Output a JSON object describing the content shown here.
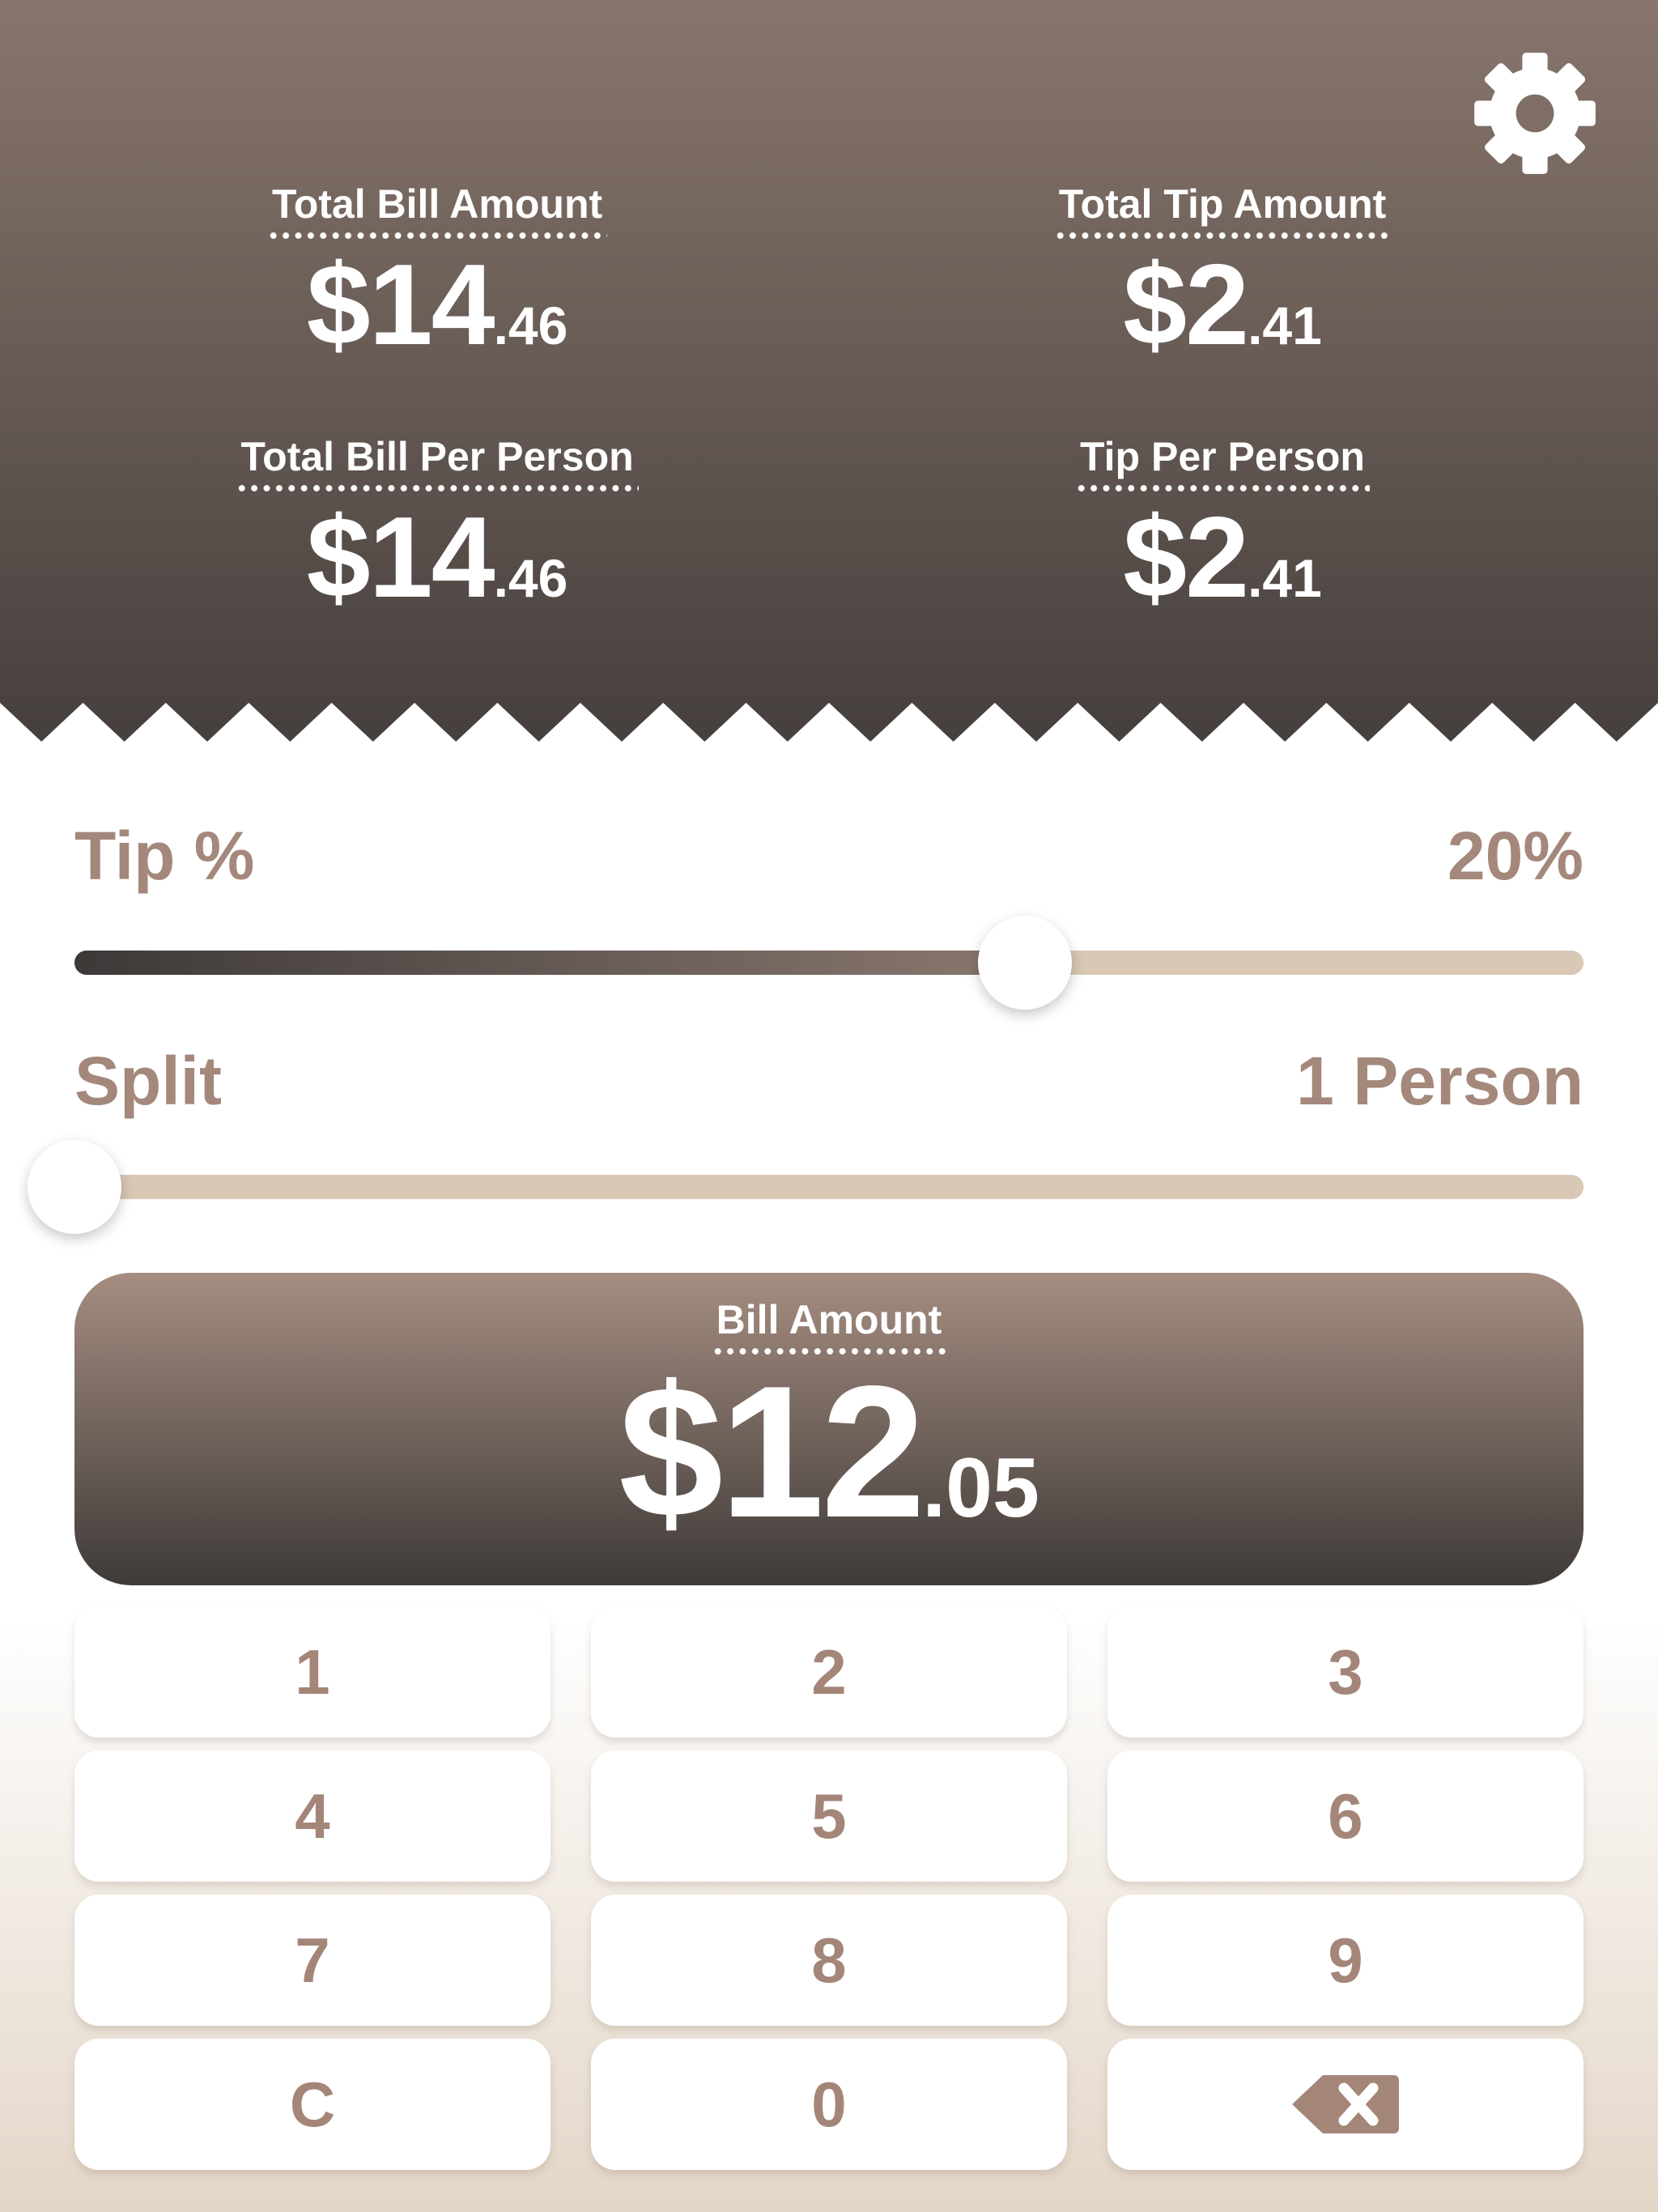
{
  "stats": {
    "total_bill": {
      "label": "Total Bill Amount",
      "dollars": "$14",
      "cents": ".46"
    },
    "total_tip": {
      "label": "Total Tip Amount",
      "dollars": "$2",
      "cents": ".41"
    },
    "bill_per_person": {
      "label": "Total Bill Per Person",
      "dollars": "$14",
      "cents": ".46"
    },
    "tip_per_person": {
      "label": "Tip Per Person",
      "dollars": "$2",
      "cents": ".41"
    }
  },
  "tip": {
    "label": "Tip %",
    "value_text": "20%",
    "level": 0.63
  },
  "split": {
    "label": "Split",
    "value_text": "1 Person",
    "level": 0.0
  },
  "bill": {
    "label": "Bill Amount",
    "dollars": "$12",
    "cents": ".05"
  },
  "keypad": {
    "keys": [
      "1",
      "2",
      "3",
      "4",
      "5",
      "6",
      "7",
      "8",
      "9",
      "C",
      "0"
    ],
    "backspace_icon": "backspace-icon"
  },
  "icons": {
    "settings": "gear-icon"
  },
  "colors": {
    "header_top": "#88766c",
    "header_bottom": "#453f3d",
    "accent_text": "#a4887b",
    "track": "#d8c8b4",
    "key_text": "#a48679"
  }
}
